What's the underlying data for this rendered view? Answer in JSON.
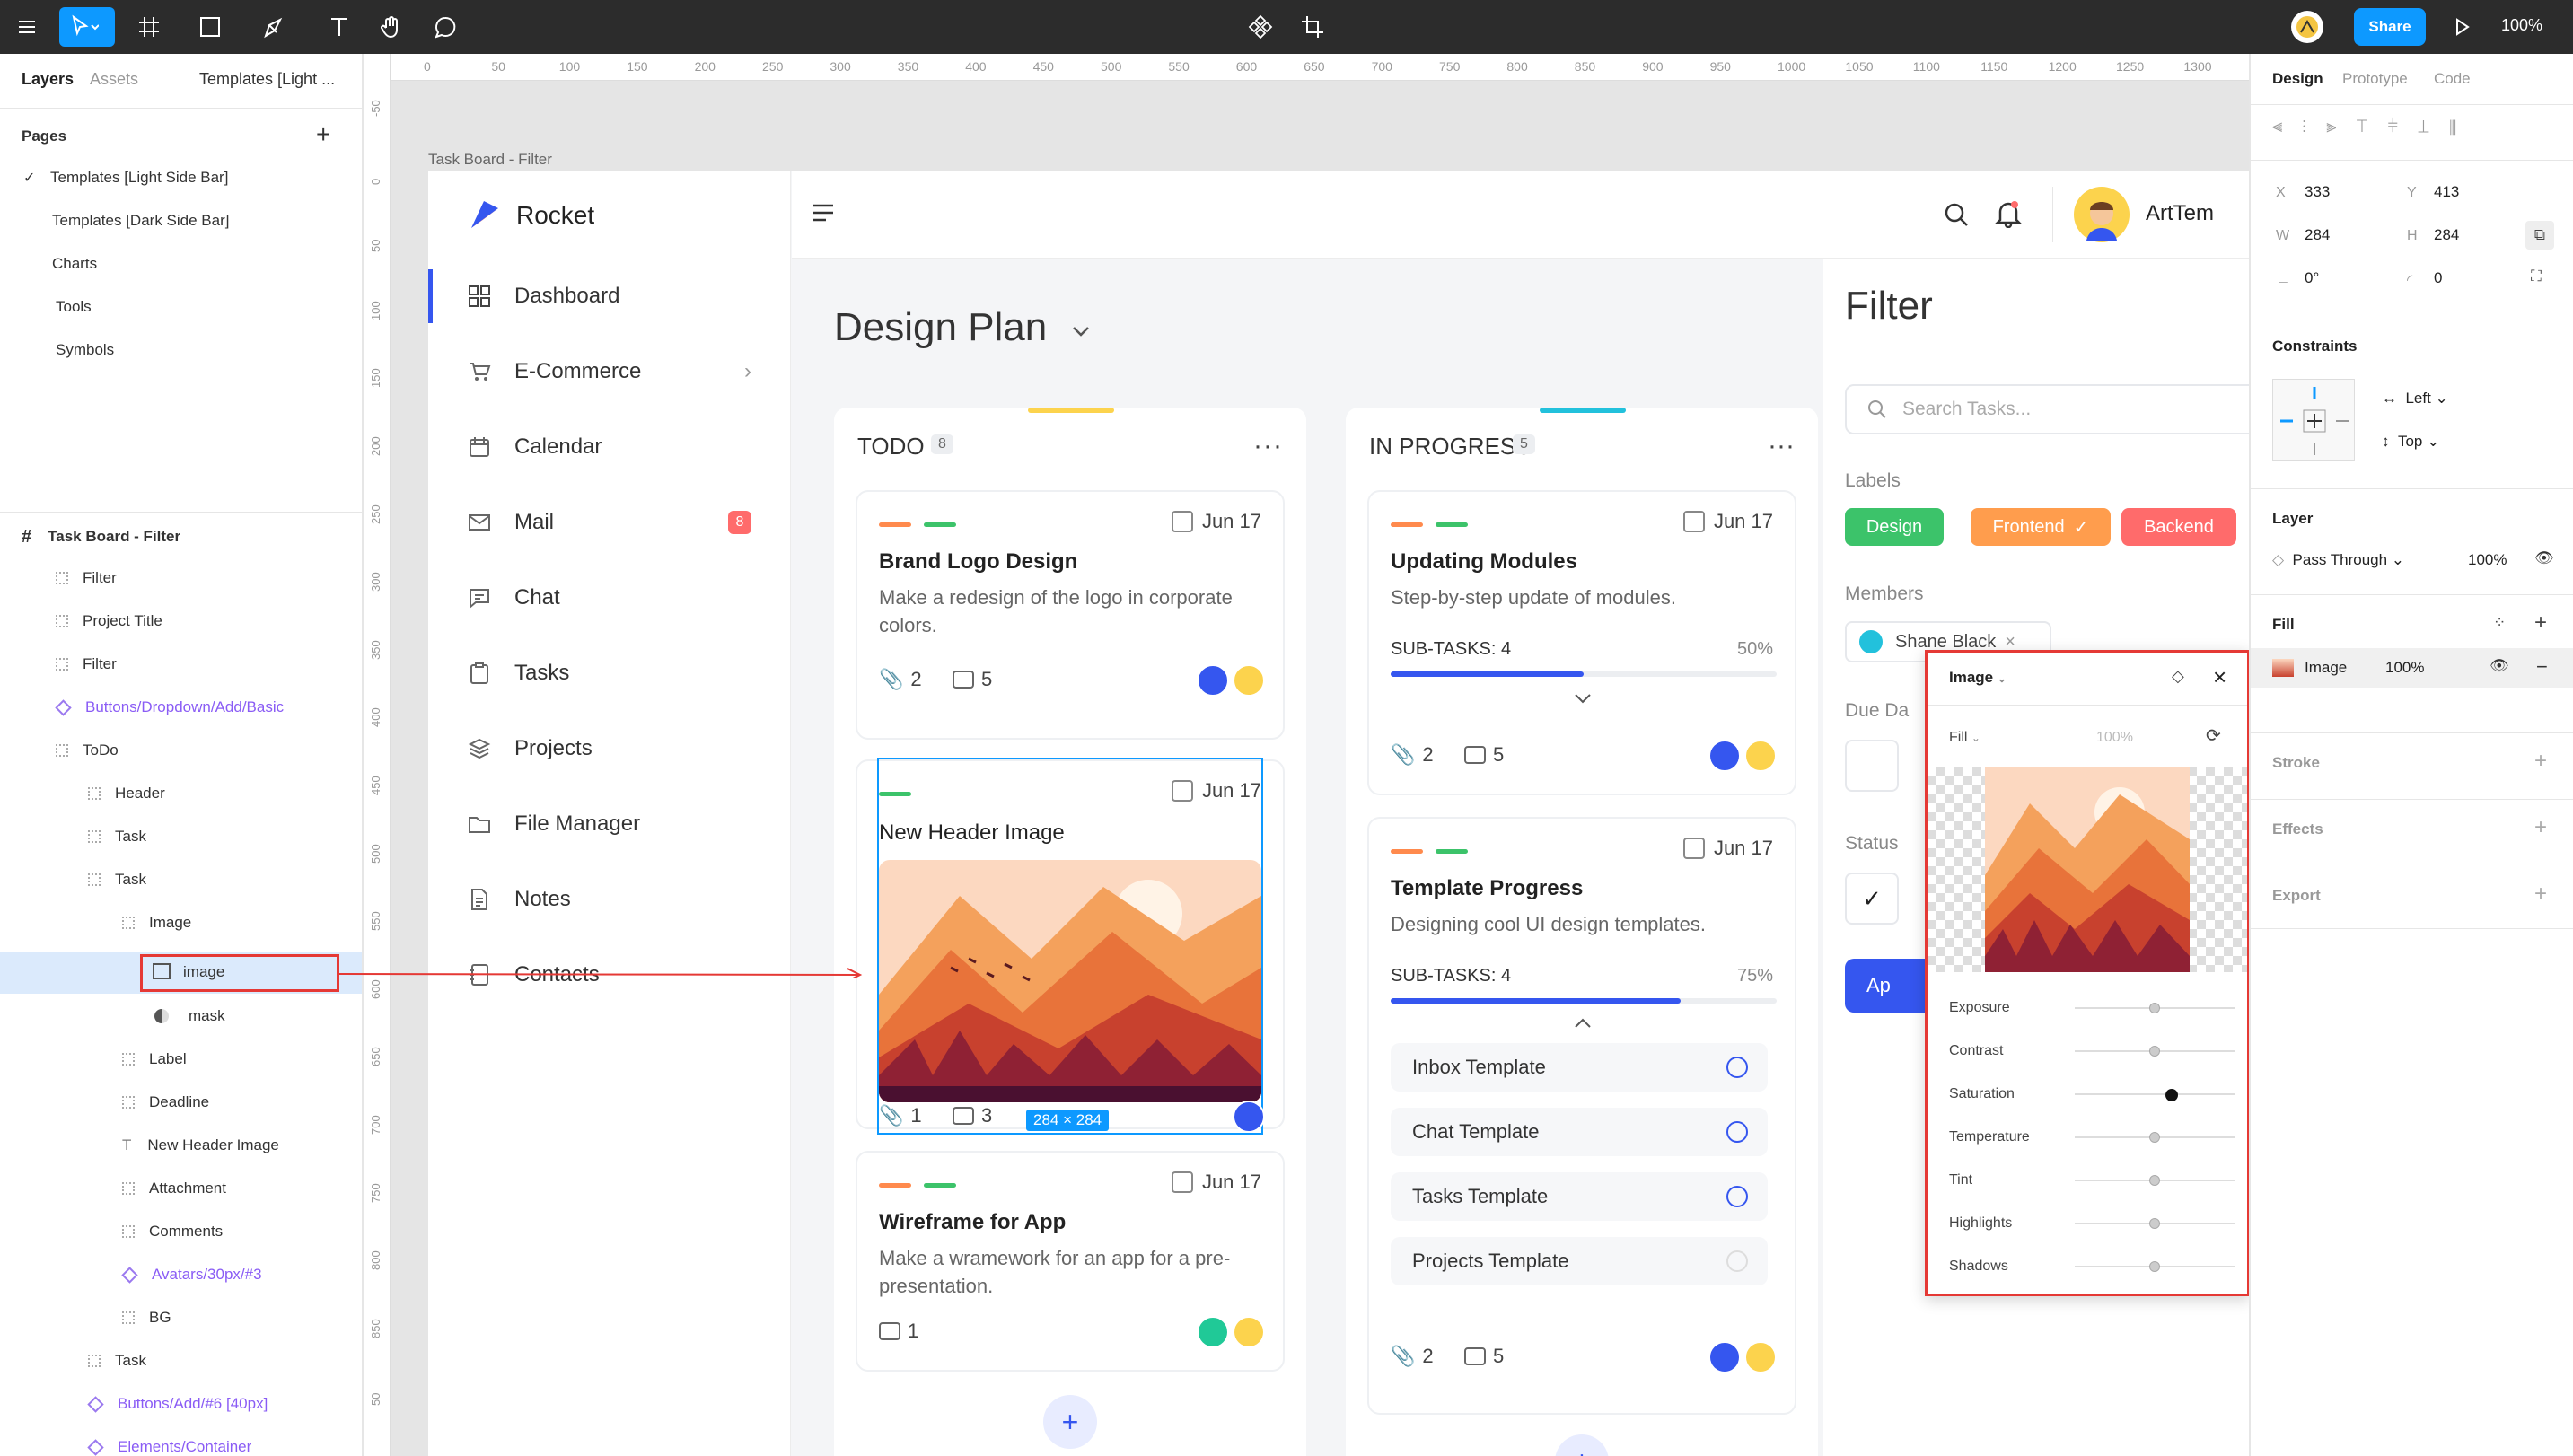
{
  "toolbar": {
    "share_label": "Share",
    "zoom": "100%",
    "icons": [
      "menu-icon",
      "move-tool-icon",
      "frame-tool-icon",
      "shape-tool-icon",
      "pen-tool-icon",
      "text-tool-icon",
      "hand-tool-icon",
      "comment-tool-icon",
      "component-icon",
      "crop-icon",
      "play-icon"
    ]
  },
  "left_panel": {
    "tabs": [
      "Layers",
      "Assets",
      "Templates [Light ..."
    ],
    "pages_title": "Pages",
    "pages": [
      "Templates [Light Side Bar]",
      "Templates [Dark Side Bar]",
      "Charts",
      "Tools",
      "Symbols"
    ],
    "frame_title": "Task Board - Filter",
    "layers": [
      "Filter",
      "Project Title",
      "Filter",
      "Buttons/Dropdown/Add/Basic",
      "ToDo",
      "Header",
      "Task",
      "Task",
      "Image",
      "image",
      "mask",
      "Label",
      "Deadline",
      "New Header Image",
      "Attachment",
      "Comments",
      "Avatars/30px/#3",
      "BG",
      "Task",
      "Buttons/Add/#6 [40px]",
      "Elements/Container"
    ]
  },
  "ruler": {
    "top": [
      "0",
      "50",
      "100",
      "150",
      "200",
      "250",
      "300",
      "350",
      "400",
      "450",
      "500",
      "550",
      "600",
      "650",
      "700",
      "750",
      "800",
      "850",
      "900",
      "950",
      "1000",
      "1050",
      "1100",
      "1150",
      "1200",
      "1250",
      "1300",
      "135"
    ],
    "left": [
      "-50",
      "0",
      "50",
      "100",
      "150",
      "200",
      "250",
      "300",
      "350",
      "400",
      "450",
      "500",
      "550",
      "600",
      "650",
      "700",
      "750",
      "800",
      "850",
      "50"
    ]
  },
  "canvas": {
    "frame_label": "Task Board - Filter",
    "selection_size": "284 × 284"
  },
  "app": {
    "brand": "Rocket",
    "user_name": "ArtTem",
    "nav": [
      "Dashboard",
      "E-Commerce",
      "Calendar",
      "Mail",
      "Chat",
      "Tasks",
      "Projects",
      "File Manager",
      "Notes",
      "Contacts"
    ],
    "mail_badge": "8",
    "page_title": "Design Plan",
    "todo": {
      "title": "TODO",
      "count": "8",
      "cards": [
        {
          "title": "Brand Logo Design",
          "date": "Jun 17",
          "desc": "Make a redesign of the logo in corporate colors.",
          "attachments": "2",
          "comments": "5"
        },
        {
          "title": "New Header Image",
          "date": "Jun 17",
          "attachments": "1",
          "comments": "3"
        },
        {
          "title": "Wireframe for App",
          "date": "Jun 17",
          "desc": "Make a wramework for an app for a pre-presentation.",
          "comments": "1"
        }
      ]
    },
    "in_progress": {
      "title": "IN PROGRESS",
      "count": "5",
      "cards": [
        {
          "title": "Updating Modules",
          "date": "Jun 17",
          "desc": "Step-by-step update of modules.",
          "subtasks_label": "SUB-TASKS: 4",
          "percent": "50%",
          "progress": 0.5,
          "attachments": "2",
          "comments": "5"
        },
        {
          "title": "Template Progress",
          "date": "Jun 17",
          "desc": "Designing cool UI design templates.",
          "subtasks_label": "SUB-TASKS: 4",
          "percent": "75%",
          "progress": 0.75,
          "attachments": "2",
          "comments": "5",
          "subtasks": [
            "Inbox Template",
            "Chat Template",
            "Tasks Template",
            "Projects Template"
          ]
        }
      ]
    },
    "filter": {
      "title": "Filter",
      "search_placeholder": "Search Tasks...",
      "labels_title": "Labels",
      "labels": [
        "Design",
        "Frontend",
        "Backend"
      ],
      "members_title": "Members",
      "member": "Shane Black",
      "due_title": "Due Da",
      "status_title": "Status",
      "apply_label": "Ap"
    }
  },
  "right_panel": {
    "tabs": [
      "Design",
      "Prototype",
      "Code"
    ],
    "x_label": "X",
    "x": "333",
    "y_label": "Y",
    "y": "413",
    "w_label": "W",
    "w": "284",
    "h_label": "H",
    "h": "284",
    "rotation": "0°",
    "radius": "0",
    "constraints_title": "Constraints",
    "h_constraint": "Left",
    "v_constraint": "Top",
    "layer_title": "Layer",
    "blend": "Pass Through",
    "opacity": "100%",
    "fill_title": "Fill",
    "fill_type": "Image",
    "fill_opacity": "100%",
    "stroke_title": "Stroke",
    "effects_title": "Effects",
    "export_title": "Export"
  },
  "image_popup": {
    "title": "Image",
    "mode": "Fill",
    "opacity": "100%",
    "adjustments": [
      {
        "label": "Exposure",
        "value": 0.5
      },
      {
        "label": "Contrast",
        "value": 0.5
      },
      {
        "label": "Saturation",
        "value": 0.6
      },
      {
        "label": "Temperature",
        "value": 0.5
      },
      {
        "label": "Tint",
        "value": 0.5
      },
      {
        "label": "Highlights",
        "value": 0.5
      },
      {
        "label": "Shadows",
        "value": 0.5
      }
    ]
  },
  "colors": {
    "accent": "#0d99ff",
    "primary": "#3556ef",
    "design_chip": "#3cc36a",
    "frontend_chip": "#ff9d4d",
    "backend_chip": "#ff6b6b",
    "annotation": "#e53935"
  }
}
